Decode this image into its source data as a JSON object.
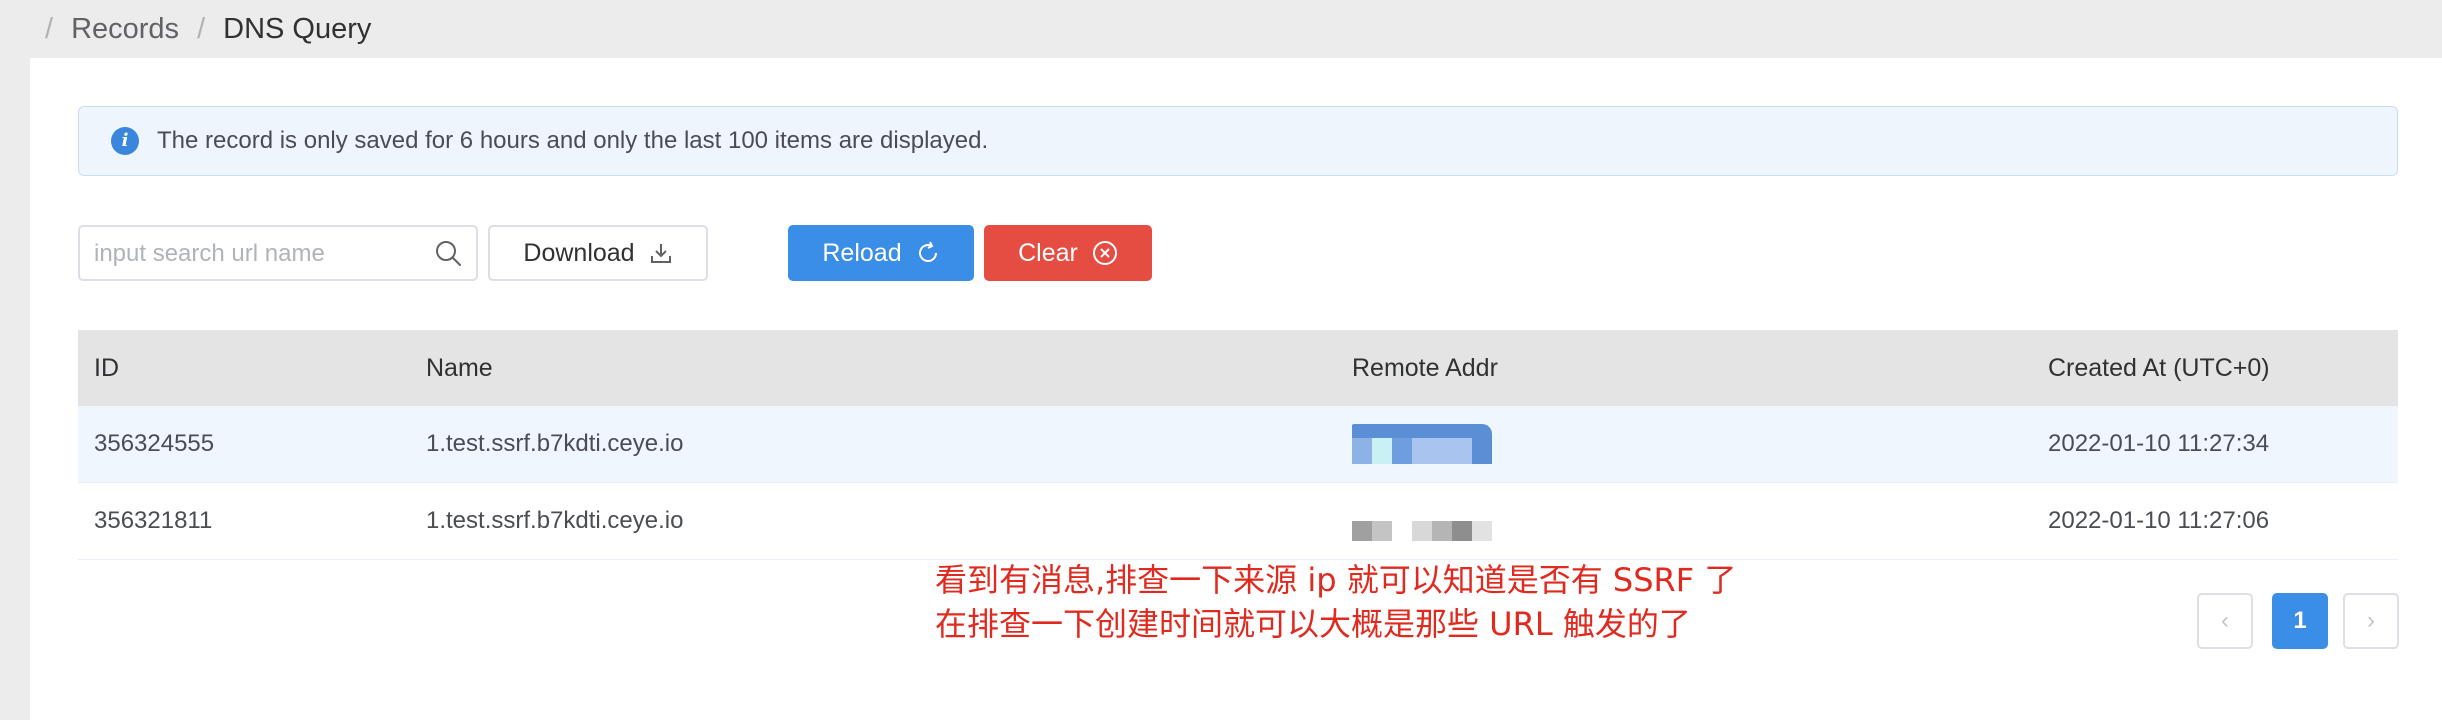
{
  "breadcrumb": {
    "items": [
      "Records",
      "DNS Query"
    ]
  },
  "alert": {
    "message": "The record is only saved for 6 hours and only the last 100 items are displayed."
  },
  "search": {
    "placeholder": "input search url name",
    "value": ""
  },
  "toolbar": {
    "download_label": "Download",
    "reload_label": "Reload",
    "clear_label": "Clear"
  },
  "table": {
    "columns": [
      "ID",
      "Name",
      "Remote Addr",
      "Created At (UTC+0)"
    ],
    "rows": [
      {
        "id": "356324555",
        "name": "1.test.ssrf.b7kdti.ceye.io",
        "remote_addr": "",
        "created": "2022-01-10 11:27:34"
      },
      {
        "id": "356321811",
        "name": "1.test.ssrf.b7kdti.ceye.io",
        "remote_addr": "",
        "created": "2022-01-10 11:27:06"
      }
    ]
  },
  "annotation": {
    "line1": "看到有消息,排查一下来源 ip 就可以知道是否有 SSRF 了",
    "line2": "在排查一下创建时间就可以大概是那些 URL 触发的了"
  },
  "pagination": {
    "prev": "‹",
    "current_page": "1",
    "next": "›"
  },
  "colors": {
    "primary": "#3a8ee6",
    "danger": "#e54d42",
    "annotation": "#e02a20"
  }
}
